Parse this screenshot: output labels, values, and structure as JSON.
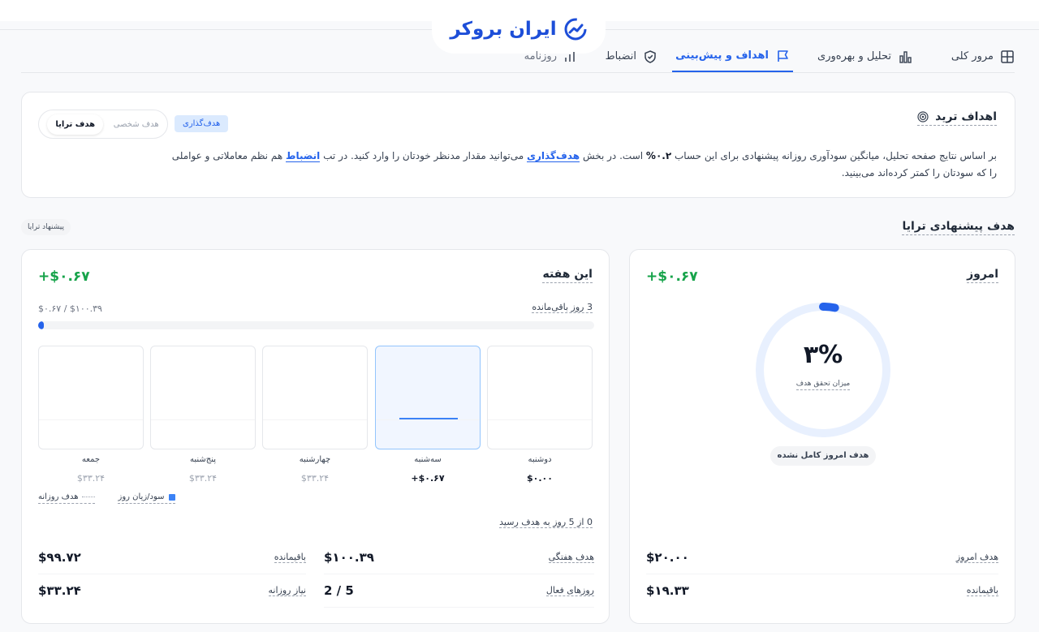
{
  "brand": {
    "logo_text": "ایران بروکر",
    "accent": "#2563eb",
    "positive": "#16a34a"
  },
  "tabs": [
    {
      "label": "مرور کلی",
      "icon": "grid-icon"
    },
    {
      "label": "تحلیل و بهره‌وری",
      "icon": "bar-chart-icon"
    },
    {
      "label": "اهداف و پیش‌بینی",
      "icon": "flag-icon",
      "active": true
    },
    {
      "label": "انضباط",
      "icon": "shield-check-icon"
    },
    {
      "label": "روزنامه",
      "icon": "journal-icon"
    }
  ],
  "goals": {
    "title": "اهداف ترید",
    "badge": "هدف‌گذاری",
    "toggle": {
      "personal": "هدف شخصی",
      "suggested": "هدف ترایا"
    },
    "desc_1": "بر اساس نتایج صفحه تحلیل، میانگین سودآوری روزانه پیشنهادی برای این حساب",
    "desc_pct": "۰.۲%",
    "desc_2": "است. در بخش",
    "desc_link_1": "هدف‌گذاری",
    "desc_3": "می‌توانید مقدار مدنظر خودتان را وارد کنید. در تب",
    "desc_link_2": "انضباط",
    "desc_4": "هم نظم معاملاتی و عواملی را که سودتان را کمتر کرده‌اند می‌بینید."
  },
  "suggested": {
    "title": "هدف پیشنهادی ترایا",
    "badge": "پیشنهاد ترایا"
  },
  "week": {
    "title": "این هفته",
    "amount": "+$۰.۶۷",
    "days_left": "3 روز باقی‌مانده",
    "progress_text": "$۰.۶۷ / $۱۰۰.۳۹",
    "progress_pct": 0.67,
    "days": [
      {
        "name": "دوشنبه",
        "value": "$۰.۰۰",
        "strong": true,
        "active": false,
        "bar": false
      },
      {
        "name": "سه‌شنبه",
        "value": "+$۰.۶۷",
        "strong": true,
        "active": true,
        "bar": true
      },
      {
        "name": "چهارشنبه",
        "value": "$۳۳.۲۴",
        "strong": false,
        "active": false,
        "bar": false
      },
      {
        "name": "پنج‌شنبه",
        "value": "$۳۳.۲۴",
        "strong": false,
        "active": false,
        "bar": false
      },
      {
        "name": "جمعه",
        "value": "$۳۳.۲۴",
        "strong": false,
        "active": false,
        "bar": false
      }
    ],
    "legend": {
      "daily_target": "هدف روزانه",
      "daily_pnl": "سود/زیان روز"
    },
    "reached": "0 از 5 روز به هدف رسید",
    "stats": {
      "weekly_target_label": "هدف هفتگی",
      "weekly_target_value": "$۱۰۰.۳۹",
      "remaining_label": "باقیمانده",
      "remaining_value": "$۹۹.۷۲",
      "active_days_label": "روزهای فعال",
      "active_days_value": "2 / 5",
      "daily_need_label": "نیاز روزانه",
      "daily_need_value": "$۳۳.۲۴"
    }
  },
  "today": {
    "title": "امروز",
    "amount": "+$۰.۶۷",
    "progress_pct": 3,
    "progress_label": "۳%",
    "progress_caption": "میزان تحقق هدف",
    "status": "هدف امروز کامل نشده",
    "target_label": "هدف امروز",
    "target_value": "$۲۰.۰۰",
    "remaining_label": "باقیمانده",
    "remaining_value": "$۱۹.۳۳"
  }
}
